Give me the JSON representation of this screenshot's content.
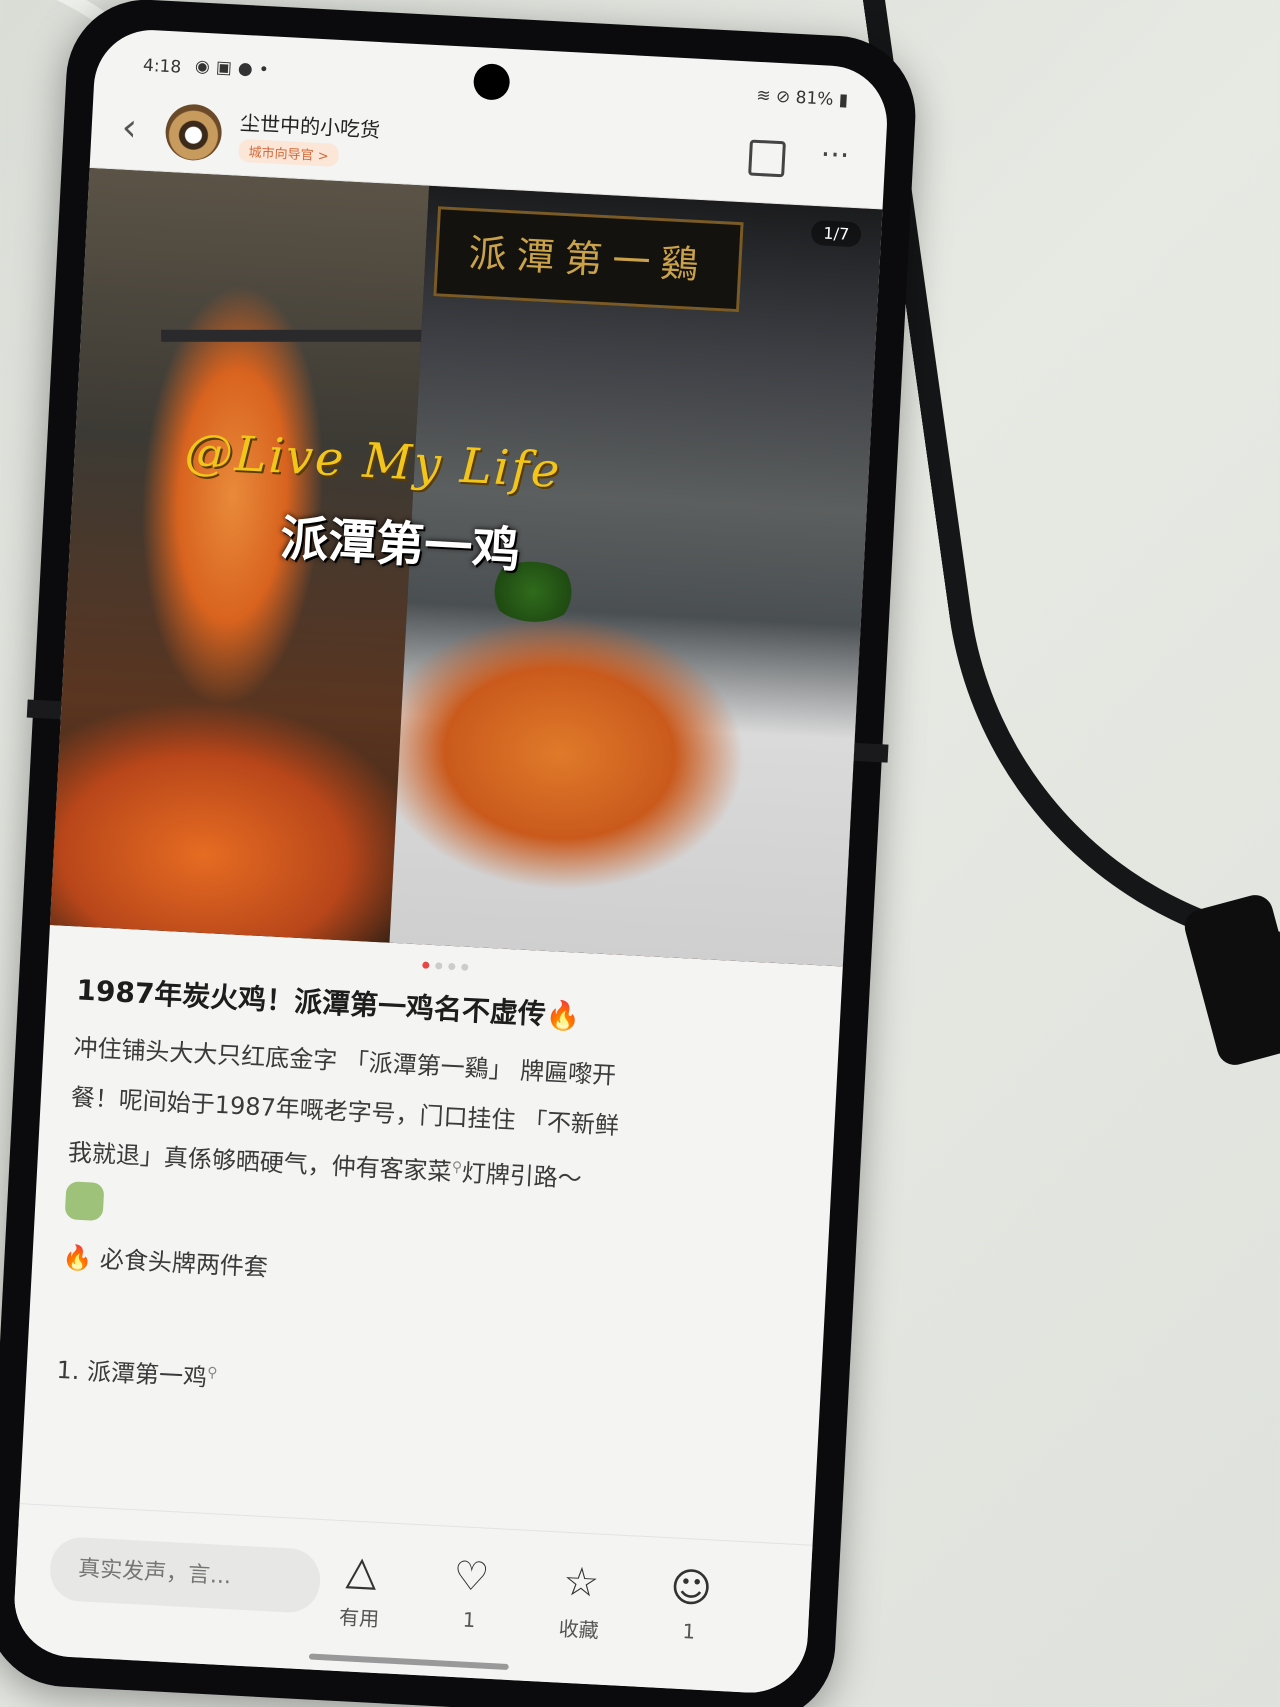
{
  "status_bar": {
    "time": "4:18",
    "battery": "81%"
  },
  "header": {
    "author_name": "尘世中的小吃货",
    "author_tag": "城市向导官 >"
  },
  "gallery": {
    "counter": "1/7",
    "watermark": "@Live My Life",
    "overlay_title": "派潭第一鸡",
    "sign_text": "派潭第一鷄",
    "active_index": 1,
    "total_dots": 4
  },
  "post": {
    "title": "1987年炭火鸡！派潭第一鸡名不虚传🔥",
    "body_line1": "冲住铺头大大只红底金字 「派潭第一鷄」 牌匾嚟开",
    "body_line2": "餐！呢间始于1987年嘅老字号，门口挂住 「不新鲜",
    "body_line3": "我就退」真係够晒硬气，仲有客家菜",
    "body_line3b": "灯牌引路～",
    "section_heading": "🔥 必食头牌两件套",
    "list_item_1": "1. 派潭第一鸡"
  },
  "bottom_bar": {
    "comment_placeholder": "真实发声，言...",
    "useful_label": "有用",
    "like_count": "1",
    "collect_label": "收藏",
    "comment_count": "1"
  },
  "icons": [
    "back-arrow-icon",
    "share-icon",
    "more-icon",
    "useful-triangle-icon",
    "heart-icon",
    "star-icon",
    "comment-icon"
  ]
}
